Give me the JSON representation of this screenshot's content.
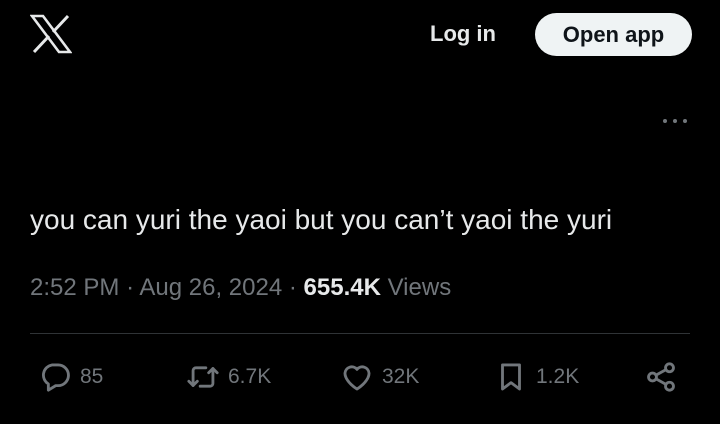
{
  "header": {
    "logo_icon": "x-logo-icon",
    "login_label": "Log in",
    "open_app_label": "Open app"
  },
  "tweet": {
    "text": "you can yuri the yaoi but you can’t yaoi the yuri",
    "time": "2:52 PM",
    "separator": "·",
    "date": "Aug 26, 2024",
    "views_count": "655.4K",
    "views_label": "Views"
  },
  "actions": {
    "replies": "85",
    "reposts": "6.7K",
    "likes": "32K",
    "bookmarks": "1.2K"
  },
  "colors": {
    "background": "#000000",
    "text_primary": "#e7e9ea",
    "text_secondary": "#71767b",
    "button_bg": "#eff3f4",
    "divider": "#2f3336"
  }
}
